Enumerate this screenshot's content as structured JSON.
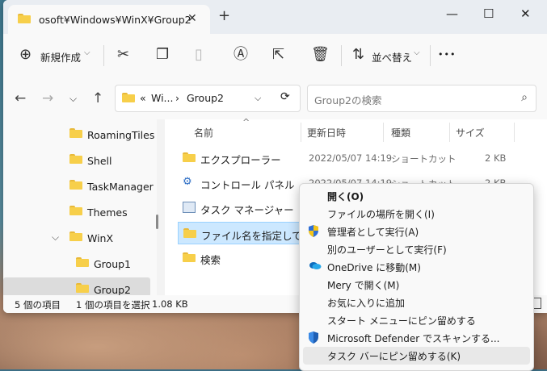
{
  "window": {
    "tab_title": "osoft¥Windows¥WinX¥Group2",
    "tab_close": "✕",
    "new_tab": "+",
    "controls": [
      "—",
      "☐",
      "✕"
    ]
  },
  "toolbar": {
    "new_label": "新規作成",
    "new_arrow": "⌵",
    "sort_label": "並べ替え",
    "sort_arrow": "⌵",
    "more": "•••",
    "icons": [
      "new-icon",
      "cut-icon",
      "copy-icon",
      "paste-icon",
      "rename-icon",
      "share-icon",
      "delete-icon",
      "sort-icon",
      "more-icon"
    ]
  },
  "nav": {
    "back": "←",
    "forward": "→",
    "recent": "⌵",
    "up": "↑",
    "address_overflow": "«",
    "address_parent": "Wi...",
    "address_sep": "›",
    "address_current": "Group2",
    "address_dropdown": "⌵",
    "refresh": "⟳",
    "search_placeholder": "Group2の検索",
    "search_icon": "⌕"
  },
  "sidebar": {
    "items": [
      {
        "label": "RoamingTiles"
      },
      {
        "label": "Shell"
      },
      {
        "label": "TaskManager"
      },
      {
        "label": "Themes"
      },
      {
        "label": "WinX",
        "chevron": "⌵"
      },
      {
        "label": "Group1"
      },
      {
        "label": "Group2"
      }
    ]
  },
  "columns": {
    "name": "名前",
    "date": "更新日時",
    "type": "種類",
    "size": "サイズ",
    "sort_indicator": "^"
  },
  "files": [
    {
      "name": "エクスプローラー",
      "date": "2022/05/07 14:19",
      "type": "ショートカット",
      "size": "2 KB"
    },
    {
      "name": "コントロール パネル",
      "date": "2022/05/07 14:19",
      "type": "ショートカット",
      "size": "2 KB"
    },
    {
      "name": "タスク マネージャー",
      "date": "",
      "type": "",
      "size": ""
    },
    {
      "name": "ファイル名を指定して実行",
      "date": "",
      "type": "",
      "size": ""
    },
    {
      "name": "検索",
      "date": "",
      "type": "",
      "size": ""
    }
  ],
  "status": {
    "count": "5 個の項目",
    "selected": "1 個の項目を選択",
    "size": "1.08 KB"
  },
  "context_menu": {
    "items": [
      {
        "label": "開く(O)",
        "bold": true,
        "icon": ""
      },
      {
        "label": "ファイルの場所を開く(I)",
        "icon": ""
      },
      {
        "label": "管理者として実行(A)",
        "icon": "uac-shield-icon"
      },
      {
        "label": "別のユーザーとして実行(F)",
        "icon": ""
      },
      {
        "label": "OneDrive に移動(M)",
        "icon": "onedrive-icon"
      },
      {
        "label": "Mery で開く(M)",
        "icon": ""
      },
      {
        "label": "お気に入りに追加",
        "icon": ""
      },
      {
        "label": "スタート メニューにピン留めする",
        "icon": ""
      },
      {
        "label": "Microsoft Defender でスキャンする...",
        "icon": "defender-icon"
      },
      {
        "label": "タスク バーにピン留めする(K)",
        "icon": "",
        "hover": true
      }
    ]
  }
}
